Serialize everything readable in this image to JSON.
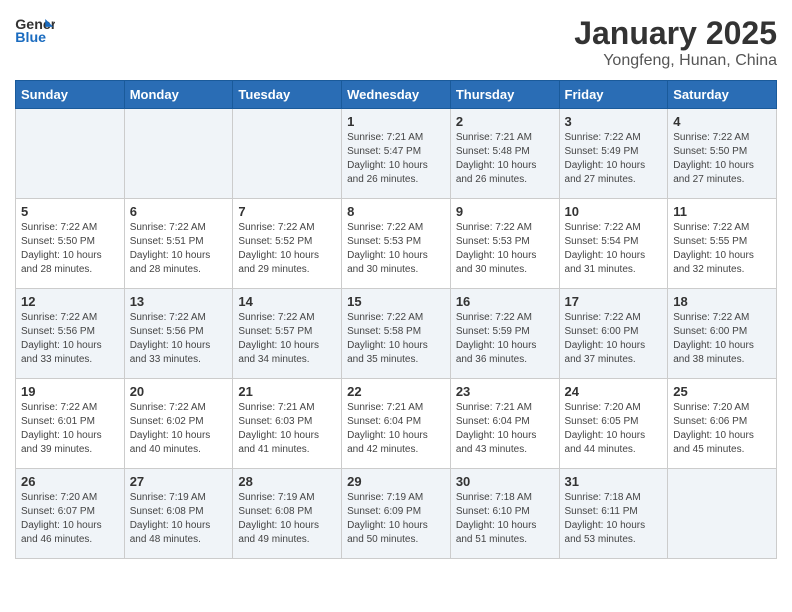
{
  "header": {
    "logo_general": "General",
    "logo_blue": "Blue",
    "month_title": "January 2025",
    "location": "Yongfeng, Hunan, China"
  },
  "weekdays": [
    "Sunday",
    "Monday",
    "Tuesday",
    "Wednesday",
    "Thursday",
    "Friday",
    "Saturday"
  ],
  "weeks": [
    [
      {
        "day": "",
        "info": ""
      },
      {
        "day": "",
        "info": ""
      },
      {
        "day": "",
        "info": ""
      },
      {
        "day": "1",
        "info": "Sunrise: 7:21 AM\nSunset: 5:47 PM\nDaylight: 10 hours\nand 26 minutes."
      },
      {
        "day": "2",
        "info": "Sunrise: 7:21 AM\nSunset: 5:48 PM\nDaylight: 10 hours\nand 26 minutes."
      },
      {
        "day": "3",
        "info": "Sunrise: 7:22 AM\nSunset: 5:49 PM\nDaylight: 10 hours\nand 27 minutes."
      },
      {
        "day": "4",
        "info": "Sunrise: 7:22 AM\nSunset: 5:50 PM\nDaylight: 10 hours\nand 27 minutes."
      }
    ],
    [
      {
        "day": "5",
        "info": "Sunrise: 7:22 AM\nSunset: 5:50 PM\nDaylight: 10 hours\nand 28 minutes."
      },
      {
        "day": "6",
        "info": "Sunrise: 7:22 AM\nSunset: 5:51 PM\nDaylight: 10 hours\nand 28 minutes."
      },
      {
        "day": "7",
        "info": "Sunrise: 7:22 AM\nSunset: 5:52 PM\nDaylight: 10 hours\nand 29 minutes."
      },
      {
        "day": "8",
        "info": "Sunrise: 7:22 AM\nSunset: 5:53 PM\nDaylight: 10 hours\nand 30 minutes."
      },
      {
        "day": "9",
        "info": "Sunrise: 7:22 AM\nSunset: 5:53 PM\nDaylight: 10 hours\nand 30 minutes."
      },
      {
        "day": "10",
        "info": "Sunrise: 7:22 AM\nSunset: 5:54 PM\nDaylight: 10 hours\nand 31 minutes."
      },
      {
        "day": "11",
        "info": "Sunrise: 7:22 AM\nSunset: 5:55 PM\nDaylight: 10 hours\nand 32 minutes."
      }
    ],
    [
      {
        "day": "12",
        "info": "Sunrise: 7:22 AM\nSunset: 5:56 PM\nDaylight: 10 hours\nand 33 minutes."
      },
      {
        "day": "13",
        "info": "Sunrise: 7:22 AM\nSunset: 5:56 PM\nDaylight: 10 hours\nand 33 minutes."
      },
      {
        "day": "14",
        "info": "Sunrise: 7:22 AM\nSunset: 5:57 PM\nDaylight: 10 hours\nand 34 minutes."
      },
      {
        "day": "15",
        "info": "Sunrise: 7:22 AM\nSunset: 5:58 PM\nDaylight: 10 hours\nand 35 minutes."
      },
      {
        "day": "16",
        "info": "Sunrise: 7:22 AM\nSunset: 5:59 PM\nDaylight: 10 hours\nand 36 minutes."
      },
      {
        "day": "17",
        "info": "Sunrise: 7:22 AM\nSunset: 6:00 PM\nDaylight: 10 hours\nand 37 minutes."
      },
      {
        "day": "18",
        "info": "Sunrise: 7:22 AM\nSunset: 6:00 PM\nDaylight: 10 hours\nand 38 minutes."
      }
    ],
    [
      {
        "day": "19",
        "info": "Sunrise: 7:22 AM\nSunset: 6:01 PM\nDaylight: 10 hours\nand 39 minutes."
      },
      {
        "day": "20",
        "info": "Sunrise: 7:22 AM\nSunset: 6:02 PM\nDaylight: 10 hours\nand 40 minutes."
      },
      {
        "day": "21",
        "info": "Sunrise: 7:21 AM\nSunset: 6:03 PM\nDaylight: 10 hours\nand 41 minutes."
      },
      {
        "day": "22",
        "info": "Sunrise: 7:21 AM\nSunset: 6:04 PM\nDaylight: 10 hours\nand 42 minutes."
      },
      {
        "day": "23",
        "info": "Sunrise: 7:21 AM\nSunset: 6:04 PM\nDaylight: 10 hours\nand 43 minutes."
      },
      {
        "day": "24",
        "info": "Sunrise: 7:20 AM\nSunset: 6:05 PM\nDaylight: 10 hours\nand 44 minutes."
      },
      {
        "day": "25",
        "info": "Sunrise: 7:20 AM\nSunset: 6:06 PM\nDaylight: 10 hours\nand 45 minutes."
      }
    ],
    [
      {
        "day": "26",
        "info": "Sunrise: 7:20 AM\nSunset: 6:07 PM\nDaylight: 10 hours\nand 46 minutes."
      },
      {
        "day": "27",
        "info": "Sunrise: 7:19 AM\nSunset: 6:08 PM\nDaylight: 10 hours\nand 48 minutes."
      },
      {
        "day": "28",
        "info": "Sunrise: 7:19 AM\nSunset: 6:08 PM\nDaylight: 10 hours\nand 49 minutes."
      },
      {
        "day": "29",
        "info": "Sunrise: 7:19 AM\nSunset: 6:09 PM\nDaylight: 10 hours\nand 50 minutes."
      },
      {
        "day": "30",
        "info": "Sunrise: 7:18 AM\nSunset: 6:10 PM\nDaylight: 10 hours\nand 51 minutes."
      },
      {
        "day": "31",
        "info": "Sunrise: 7:18 AM\nSunset: 6:11 PM\nDaylight: 10 hours\nand 53 minutes."
      },
      {
        "day": "",
        "info": ""
      }
    ]
  ]
}
